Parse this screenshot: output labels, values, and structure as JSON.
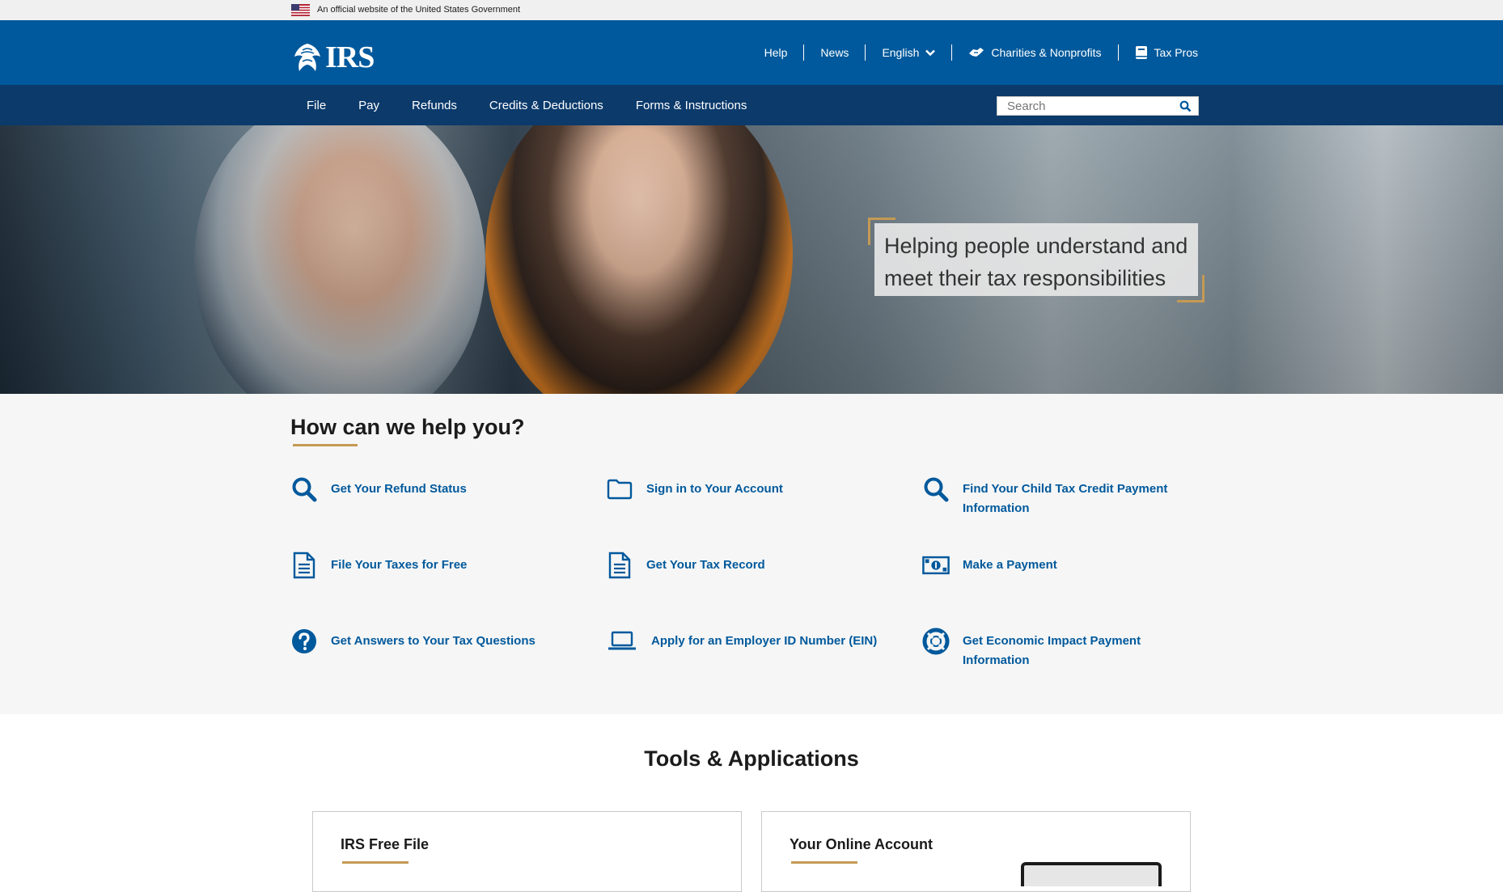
{
  "gov_banner": {
    "text": "An official website of the United States Government"
  },
  "header": {
    "logo_text": "IRS",
    "util_nav": {
      "help": "Help",
      "news": "News",
      "language": "English",
      "charities": "Charities & Nonprofits",
      "tax_pros": "Tax Pros"
    }
  },
  "main_nav": {
    "items": [
      "File",
      "Pay",
      "Refunds",
      "Credits & Deductions",
      "Forms & Instructions"
    ],
    "search_placeholder": "Search"
  },
  "hero": {
    "caption": "Helping people understand and meet their tax responsibilities"
  },
  "help": {
    "title": "How can we help you?",
    "items": [
      {
        "label": "Get Your Refund Status",
        "icon": "search-icon"
      },
      {
        "label": "Sign in to Your Account",
        "icon": "folder-icon"
      },
      {
        "label": "Find Your Child Tax Credit Payment Information",
        "icon": "search-icon"
      },
      {
        "label": "File Your Taxes for Free",
        "icon": "document-icon"
      },
      {
        "label": "Get Your Tax Record",
        "icon": "document-icon"
      },
      {
        "label": "Make a Payment",
        "icon": "money-icon"
      },
      {
        "label": "Get Answers to Your Tax Questions",
        "icon": "question-icon"
      },
      {
        "label": "Apply for an Employer ID Number (EIN)",
        "icon": "laptop-icon"
      },
      {
        "label": "Get Economic Impact Payment Information",
        "icon": "lifebuoy-icon"
      }
    ]
  },
  "tools": {
    "title": "Tools & Applications",
    "cards": [
      {
        "title": "IRS Free File"
      },
      {
        "title": "Your Online Account"
      }
    ]
  },
  "colors": {
    "header_blue": "#00599c",
    "nav_navy": "#0b3a6b",
    "link_blue": "#00599c",
    "gold_accent": "#c49a54"
  }
}
